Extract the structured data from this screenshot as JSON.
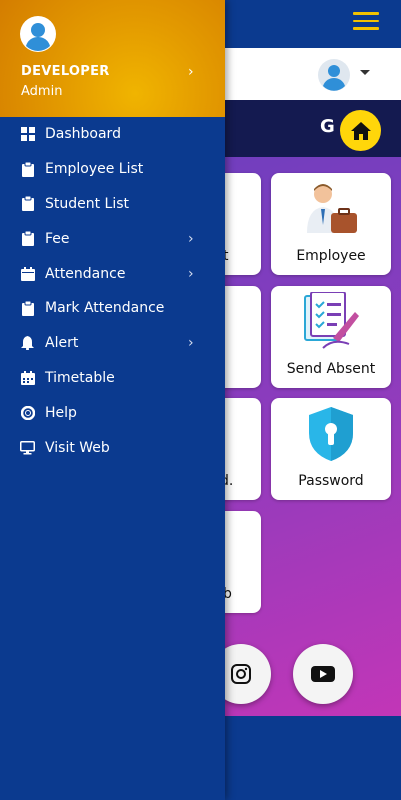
{
  "drawer": {
    "user_name": "DEVELOPER",
    "user_role": "Admin",
    "items": [
      {
        "label": "Dashboard",
        "icon": "dashboard-icon",
        "submenu": false
      },
      {
        "label": "Employee List",
        "icon": "clipboard-icon",
        "submenu": false
      },
      {
        "label": "Student List",
        "icon": "clipboard-icon",
        "submenu": false
      },
      {
        "label": "Fee",
        "icon": "clipboard-icon",
        "submenu": true
      },
      {
        "label": "Attendance",
        "icon": "calendar-icon",
        "submenu": true
      },
      {
        "label": "Mark Attendance",
        "icon": "clipboard-icon",
        "submenu": false
      },
      {
        "label": "Alert",
        "icon": "bell-icon",
        "submenu": true
      },
      {
        "label": "Timetable",
        "icon": "calendar-icon",
        "submenu": false
      },
      {
        "label": "Help",
        "icon": "lifebuoy-icon",
        "submenu": false
      },
      {
        "label": "Visit Web",
        "icon": "monitor-icon",
        "submenu": false
      }
    ]
  },
  "header": {
    "title_fragment": "G"
  },
  "cards": {
    "employee": "Employee",
    "send_absent": "Send Absent",
    "password": "Password",
    "partial_1": "t",
    "partial_2": "d.",
    "partial_3": "b"
  },
  "colors": {
    "primary": "#0b3a8f",
    "accent": "#ffd60a",
    "header_gradient": "#e39a00"
  }
}
